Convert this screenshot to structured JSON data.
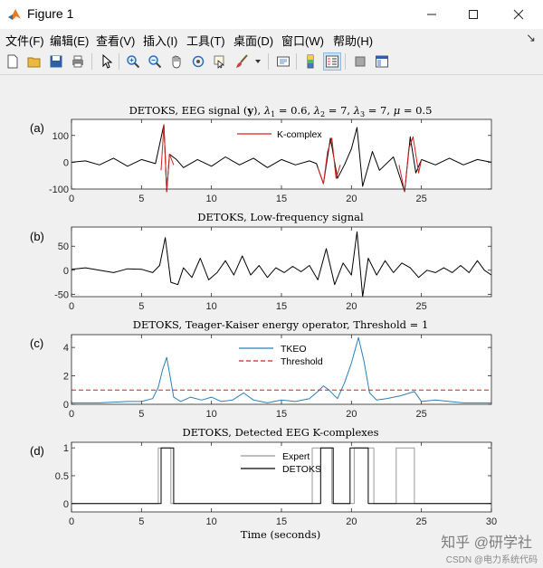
{
  "window": {
    "title": "Figure 1",
    "minimize_icon": "minimize-icon",
    "maximize_icon": "maximize-icon",
    "close_icon": "close-icon"
  },
  "menu": [
    "文件(F)",
    "编辑(E)",
    "查看(V)",
    "插入(I)",
    "工具(T)",
    "桌面(D)",
    "窗口(W)",
    "帮助(H)"
  ],
  "toolbar_icons": [
    "new-figure-icon",
    "open-file-icon",
    "save-icon",
    "print-icon",
    "pointer-icon",
    "zoom-in-icon",
    "zoom-out-icon",
    "pan-hand-icon",
    "rotate-3d-icon",
    "data-cursor-icon",
    "brush-icon",
    "brush-dropdown-icon",
    "link-plot-icon",
    "colorbar-icon",
    "legend-icon",
    "hide-plot-tools-icon",
    "show-plot-tools-icon"
  ],
  "colors": {
    "signal": "#000000",
    "kcomplex": "#d62020",
    "tkeo": "#2c7fb8",
    "threshold": "#d62020",
    "expert": "#999999",
    "detoks": "#000000"
  },
  "chart_data": [
    {
      "type": "line",
      "panel_label": "(a)",
      "title": "DETOKS, EEG signal (y), λ1 = 0.6, λ2 = 7, λ3 = 7, μ = 0.5",
      "title_parts": {
        "prefix": "DETOKS, EEG signal (",
        "bold_y": "y",
        "mid": "), ",
        "l1": "λ",
        "s1": "1",
        "e1": " = 0.6, ",
        "l2": "λ",
        "s2": "2",
        "e2": " = 7, ",
        "l3": "λ",
        "s3": "3",
        "e3": " = 7, ",
        "mu": "μ",
        "e4": " = 0.5"
      },
      "xlim": [
        0,
        30
      ],
      "ylim": [
        -100,
        160
      ],
      "xticks": [
        0,
        5,
        10,
        15,
        20,
        25
      ],
      "yticks": [
        -100,
        0,
        100
      ],
      "legend": [
        "K-complex"
      ],
      "series": [
        {
          "name": "",
          "x": [
            0,
            1,
            2,
            3,
            4,
            5,
            6,
            6.6,
            6.8,
            7,
            7.5,
            8,
            9,
            10,
            11,
            12,
            13,
            14,
            15,
            16,
            17,
            17.5,
            18,
            18.5,
            19,
            19.5,
            20,
            20.4,
            20.8,
            21.5,
            22,
            23,
            23.8,
            24.2,
            24.6,
            25,
            26,
            27,
            28,
            29,
            30
          ],
          "values": [
            0,
            5,
            -10,
            15,
            -15,
            10,
            -5,
            140,
            -110,
            30,
            10,
            -20,
            10,
            -15,
            20,
            -10,
            15,
            -20,
            10,
            -10,
            5,
            -5,
            -80,
            90,
            -60,
            -10,
            50,
            130,
            -90,
            40,
            -30,
            20,
            -110,
            95,
            -40,
            10,
            -10,
            15,
            -10,
            10,
            0
          ]
        },
        {
          "name": "K-complex",
          "segments": [
            {
              "x": [
                6.4,
                6.6,
                6.8,
                7.0,
                7.3
              ],
              "values": [
                -30,
                140,
                -110,
                30,
                -10
              ]
            },
            {
              "x": [
                17.6,
                18.0,
                18.3,
                18.6,
                18.9,
                19.2
              ],
              "values": [
                -20,
                -80,
                40,
                90,
                -60,
                -10
              ]
            },
            {
              "x": [
                23.4,
                23.8,
                24.1,
                24.4,
                24.8,
                25.0
              ],
              "values": [
                -10,
                -110,
                50,
                95,
                -40,
                10
              ]
            }
          ]
        }
      ]
    },
    {
      "type": "line",
      "panel_label": "(b)",
      "title": "DETOKS, Low-frequency signal",
      "xlim": [
        0,
        30
      ],
      "ylim": [
        -55,
        90
      ],
      "xticks": [
        0,
        5,
        10,
        15,
        20,
        25
      ],
      "yticks": [
        -50,
        0,
        50
      ],
      "series": [
        {
          "name": "",
          "x": [
            0,
            1,
            2,
            3,
            4,
            5,
            5.8,
            6.3,
            6.7,
            7.1,
            7.6,
            8,
            8.6,
            9.2,
            9.8,
            10.4,
            11,
            11.6,
            12.2,
            12.8,
            13.4,
            14,
            14.6,
            15.2,
            15.8,
            16.4,
            17,
            17.6,
            18.2,
            18.8,
            19.4,
            20,
            20.4,
            20.8,
            21.2,
            21.8,
            22.4,
            23,
            23.6,
            24.2,
            24.8,
            25.4,
            26,
            26.6,
            27.2,
            27.8,
            28.4,
            29,
            29.5,
            30
          ],
          "values": [
            2,
            5,
            0,
            -5,
            3,
            2,
            -5,
            10,
            68,
            -25,
            -30,
            5,
            -15,
            25,
            -20,
            -5,
            20,
            -10,
            30,
            -10,
            10,
            -15,
            5,
            -5,
            8,
            -3,
            10,
            -20,
            45,
            -30,
            15,
            -10,
            80,
            -55,
            25,
            -10,
            20,
            -5,
            15,
            5,
            -15,
            0,
            -5,
            5,
            -5,
            10,
            -5,
            20,
            0,
            -10
          ]
        }
      ]
    },
    {
      "type": "line",
      "panel_label": "(c)",
      "title": "DETOKS, Teager-Kaiser energy operator, Threshold = 1",
      "xlim": [
        0,
        30
      ],
      "ylim": [
        0,
        4.9
      ],
      "xticks": [
        0,
        5,
        10,
        15,
        20,
        25
      ],
      "yticks": [
        0,
        2,
        4
      ],
      "legend": [
        "TKEO",
        "Threshold"
      ],
      "threshold": 1,
      "series": [
        {
          "name": "TKEO",
          "x": [
            0,
            2,
            4,
            5,
            5.8,
            6.2,
            6.5,
            6.8,
            7.0,
            7.3,
            7.8,
            8.5,
            9.3,
            10,
            10.7,
            11.5,
            12.3,
            13,
            14,
            15,
            16,
            17,
            17.6,
            18,
            18.4,
            19,
            19.5,
            20,
            20.5,
            20.9,
            21.3,
            21.8,
            22.5,
            23.5,
            24.5,
            25,
            26,
            27,
            28,
            29,
            30
          ],
          "values": [
            0.1,
            0.1,
            0.2,
            0.2,
            0.4,
            1.2,
            2.4,
            3.3,
            2.2,
            0.5,
            0.2,
            0.5,
            0.3,
            0.5,
            0.2,
            0.3,
            0.8,
            0.3,
            0.1,
            0.3,
            0.2,
            0.4,
            0.9,
            1.3,
            1.0,
            0.4,
            1.5,
            2.9,
            4.7,
            3.0,
            0.8,
            0.3,
            0.4,
            0.6,
            0.9,
            0.2,
            0.3,
            0.2,
            0.1,
            0.1,
            0.1
          ]
        },
        {
          "name": "Threshold",
          "x": [
            0,
            30
          ],
          "values": [
            1,
            1
          ]
        }
      ]
    },
    {
      "type": "line",
      "panel_label": "(d)",
      "title": "DETOKS, Detected EEG K-complexes",
      "xlabel": "Time (seconds)",
      "xlim": [
        0,
        30
      ],
      "ylim": [
        -0.15,
        1.1
      ],
      "xticks": [
        0,
        5,
        10,
        15,
        20,
        25,
        30
      ],
      "yticks": [
        0,
        0.5,
        1
      ],
      "ytick_labels": [
        "0",
        "0.5",
        "1"
      ],
      "legend": [
        "Expert",
        "DETOKS"
      ],
      "series": [
        {
          "name": "Expert",
          "x": [
            0,
            6.2,
            6.2,
            7.1,
            7.1,
            17.2,
            17.2,
            18.6,
            18.6,
            20.2,
            20.2,
            21.6,
            21.6,
            23.2,
            23.2,
            24.5,
            24.5,
            30
          ],
          "values": [
            0,
            0,
            1,
            1,
            0,
            0,
            1,
            1,
            0,
            0,
            1,
            1,
            0,
            0,
            1,
            1,
            0,
            0
          ]
        },
        {
          "name": "DETOKS",
          "x": [
            0,
            6.4,
            6.4,
            7.3,
            7.3,
            17.8,
            17.8,
            18.7,
            18.7,
            19.9,
            19.9,
            21.2,
            21.2,
            30
          ],
          "values": [
            0,
            0,
            1,
            1,
            0,
            0,
            1,
            1,
            0,
            0,
            1,
            1,
            0,
            0
          ]
        }
      ]
    }
  ],
  "watermark": {
    "line1": "知乎 @研学社",
    "line2": "CSDN @电力系统代码"
  }
}
